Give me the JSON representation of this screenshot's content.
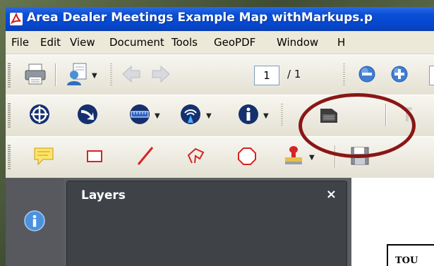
{
  "window": {
    "title": "Area Dealer Meetings Example Map withMarkups.p"
  },
  "menu": [
    "File",
    "Edit",
    "View",
    "Document",
    "Tools",
    "GeoPDF",
    "Window",
    "H"
  ],
  "navigation": {
    "page_current": "1",
    "page_total": "/ 1"
  },
  "panel": {
    "title": "Layers",
    "close_label": "×"
  },
  "document": {
    "visible_text": "TOU"
  },
  "colors": {
    "highlight_ring": "#8a1616",
    "title_bar": "#0548d0"
  },
  "icons": {
    "toolbar1": [
      "print-icon",
      "document-properties-icon",
      "previous-page-icon",
      "next-page-icon",
      "zoom-out-icon",
      "zoom-in-icon"
    ],
    "toolbar2": [
      "globe-crosshair-icon",
      "navigate-arrow-icon",
      "measure-ruler-icon",
      "gps-signal-icon",
      "info-icon",
      "tablet-icon"
    ],
    "toolbar3": [
      "comment-note-icon",
      "rectangle-markup-icon",
      "line-markup-icon",
      "polygon-line-icon",
      "polygon-icon",
      "stamp-icon",
      "save-icon"
    ]
  }
}
